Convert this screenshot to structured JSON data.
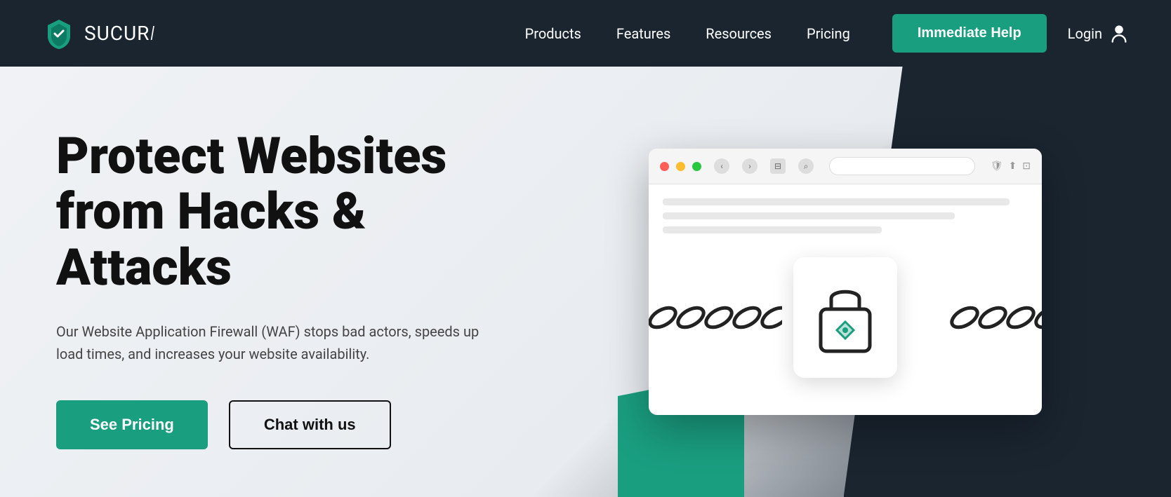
{
  "navbar": {
    "logo_text": "SUCUR",
    "logo_i": "i",
    "nav_items": [
      {
        "label": "Products",
        "id": "nav-products"
      },
      {
        "label": "Features",
        "id": "nav-features"
      },
      {
        "label": "Resources",
        "id": "nav-resources"
      },
      {
        "label": "Pricing",
        "id": "nav-pricing"
      }
    ],
    "immediate_help_label": "Immediate Help",
    "login_label": "Login"
  },
  "hero": {
    "title": "Protect Websites from Hacks & Attacks",
    "subtitle": "Our Website Application Firewall (WAF) stops bad actors, speeds up load times, and increases your website availability.",
    "btn_primary_label": "See Pricing",
    "btn_secondary_label": "Chat with us"
  },
  "colors": {
    "teal": "#1a9e80",
    "dark": "#1a2530",
    "white": "#ffffff"
  }
}
